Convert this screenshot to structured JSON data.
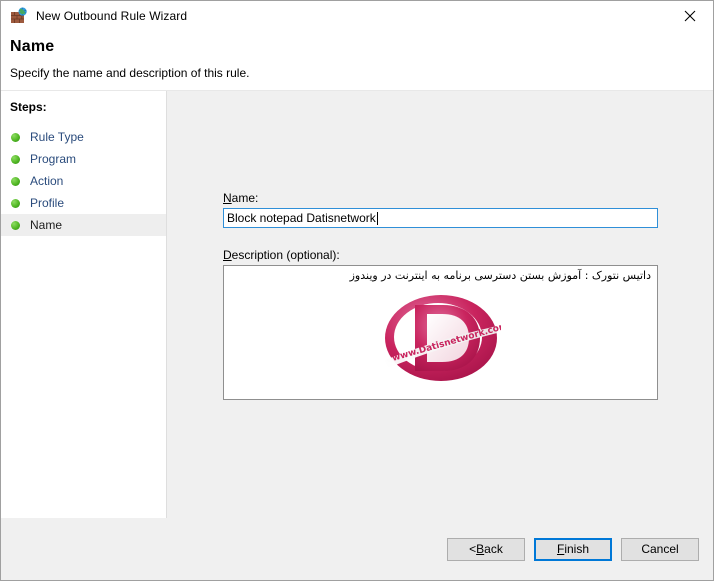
{
  "window": {
    "title": "New Outbound Rule Wizard",
    "icon": "firewall-globe-icon",
    "close_label": "✕"
  },
  "header": {
    "title": "Name",
    "subtitle": "Specify the name and description of this rule."
  },
  "sidebar": {
    "heading": "Steps:",
    "items": [
      {
        "label": "Rule Type",
        "active": false
      },
      {
        "label": "Program",
        "active": false
      },
      {
        "label": "Action",
        "active": false
      },
      {
        "label": "Profile",
        "active": false
      },
      {
        "label": "Name",
        "active": true
      }
    ]
  },
  "form": {
    "name_label_pre": "N",
    "name_label_post": "ame:",
    "name_value": "Block notepad Datisnetwork",
    "name_placeholder": "",
    "description_label_pre": "D",
    "description_label_post": "escription (optional):",
    "description_value": "داتیس نتورک :  آموزش بستن دسترسی برنامه به اینترنت در ویندوز",
    "description_placeholder": ""
  },
  "logo": {
    "letter": "D",
    "ribbon_text": "www.Datisnetwork.com",
    "color_primary": "#c9245e",
    "color_light": "#e87fa8"
  },
  "footer": {
    "back_pre": "< ",
    "back_key": "B",
    "back_post": "ack",
    "finish_pre": "",
    "finish_key": "F",
    "finish_post": "inish",
    "cancel_label": "Cancel"
  },
  "colors": {
    "accent": "#0078d7",
    "panel_bg": "#f0f0f0",
    "sidebar_bg": "#ffffff",
    "step_link": "#2a4b7c",
    "step_bullet": "#51b724"
  }
}
